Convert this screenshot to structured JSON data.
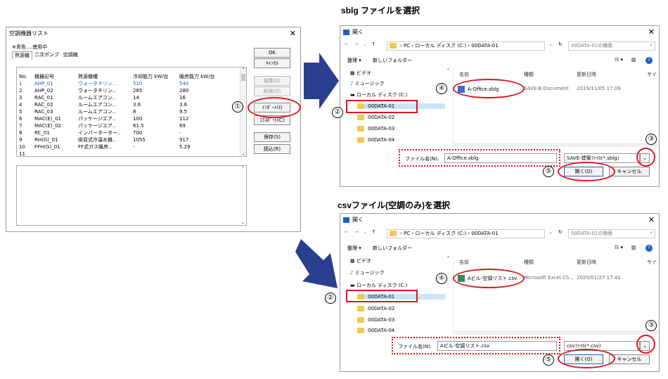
{
  "colors": {
    "accent_red": "#e0141e",
    "arrow_blue": "#2b3f8f",
    "blue_text": "#1f5fc4"
  },
  "left": {
    "title": "空調機器リスト",
    "note": "※青色‥‥使用中",
    "tabs": [
      "熱源機",
      "二次ポンプ",
      "空調機"
    ],
    "headers": [
      "No.",
      "機器記号",
      "熱源機種",
      "冷却能力 kW/台",
      "暖房能力 kW/台"
    ],
    "rows": [
      [
        "1",
        "AHP_01",
        "ウォータチリン..",
        "510",
        "540"
      ],
      [
        "2",
        "AHP_02",
        "ウォータチリン..",
        "265",
        "280"
      ],
      [
        "3",
        "RAC_01",
        "ルームエアコン..",
        "14",
        "16"
      ],
      [
        "4",
        "RAC_02",
        "ルームエアコン..",
        "3.6",
        "3.6"
      ],
      [
        "5",
        "RAC_03",
        "ルームエアコン..",
        "8",
        "9.5"
      ],
      [
        "6",
        "MAC(E)_01",
        "パッケージエア..",
        "100",
        "112"
      ],
      [
        "7",
        "MAC(E)_02",
        "パッケージエア..",
        "61.5",
        "69"
      ],
      [
        "8",
        "RC_01",
        "インバーターター..",
        "700",
        "-"
      ],
      [
        "9",
        "RH(G)_01",
        "吸収式冷温水機..",
        "1055",
        "917"
      ],
      [
        "10",
        "FFH(G)_01",
        "FF式ガス暖房..",
        "-",
        "5.29"
      ],
      [
        "11",
        "",
        "",
        "",
        ""
      ]
    ],
    "buttons": {
      "ok": "OK",
      "cancel": "ｷｬﾝｾﾙ",
      "edit": "編集(E)",
      "delete": "削除(D)",
      "import": "ｲﾝﾎﾟｰﾄ(I)",
      "export": "ｴｸｽﾎﾟｰﾄ(C)",
      "save": "保存(S)",
      "load": "読込(R)"
    }
  },
  "top": {
    "caption": "sblg ファイルを選択",
    "title": "開く",
    "path": [
      "PC",
      "ローカル ディスク (C:)",
      "00DATA-01"
    ],
    "search_placeholder": "00DATA-01の検索",
    "organize": "整理 ▾",
    "new_folder": "新しいフォルダー",
    "nav": [
      "ビデオ",
      "ミュージック",
      "ローカル ディスク (C:)",
      "00DATA-01",
      "00DATA-02",
      "00DATA-03",
      "00DATA-04"
    ],
    "col_headers": [
      "名前",
      "種類",
      "更新日時",
      "サイ"
    ],
    "file_name": "A-Office.sblg",
    "file_type": "SAVE-B Document",
    "file_date": "2019/11/05 17:09",
    "filename_label": "ファイル名(N):",
    "filename_value": "A-Office.sblg",
    "filter": "SAVE-建築ﾌｧｲﾙ(*.sblg)",
    "open": "開く(O)",
    "cancel": "キャンセル"
  },
  "bottom": {
    "caption": "csvファイル(空調のみ)を選択",
    "title": "開く",
    "path": [
      "PC",
      "ローカル ディスク (C:)",
      "00DATA-01"
    ],
    "search_placeholder": "00DATA-01の検索",
    "organize": "整理 ▾",
    "new_folder": "新しいフォルダー",
    "nav": [
      "ビデオ",
      "ミュージック",
      "ローカル ディスク (C:)",
      "00DATA-01",
      "00DATA-02",
      "00DATA-03",
      "00DATA-04"
    ],
    "col_headers": [
      "名前",
      "種類",
      "更新日時",
      "サイ"
    ],
    "file_name": "Aビル-空調リスト.csv",
    "file_type": "Microsoft Excel CS...",
    "file_date": "2020/01/27 17:41",
    "filename_label": "ファイル名(N):",
    "filename_value": "Aビル-空調リスト.csv",
    "filter": "csvﾌｧｲﾙ(*.csv)",
    "open": "開く(O)",
    "cancel": "キャンセル"
  },
  "steps": [
    "①",
    "②",
    "③",
    "④",
    "⑤"
  ]
}
